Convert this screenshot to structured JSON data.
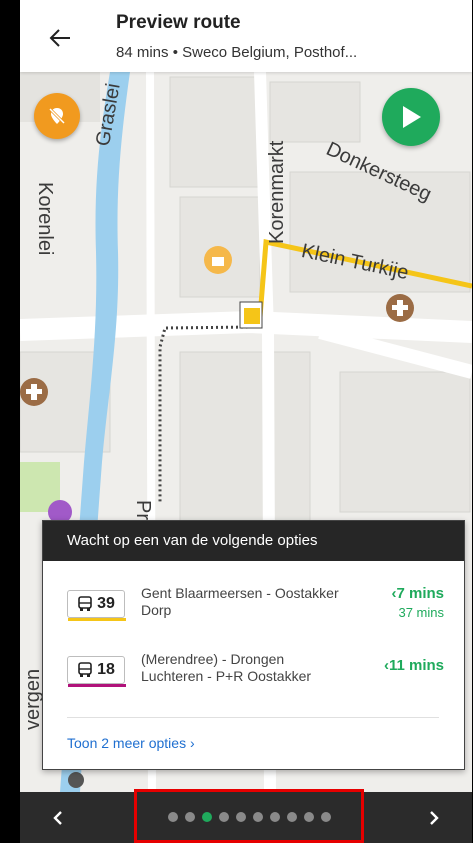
{
  "header": {
    "back_icon": "arrow-left-icon",
    "title": "Preview route",
    "subtitle": "84 mins • Sweco Belgium, Posthof..."
  },
  "map": {
    "labels": {
      "graslei": "Graslei",
      "korenlei": "Korenlei",
      "korenmarkt": "Korenmarkt",
      "donkersteeg": "Donkersteeg",
      "klein_turkije": "Klein Turkije",
      "pre": "Pre",
      "vergen": "vergen"
    },
    "buttons": {
      "location_off_icon": "location-off-icon",
      "start_icon": "play-icon"
    },
    "colors": {
      "water": "#9ccfee",
      "route": "#f5c518",
      "walk": "#444444",
      "green_area": "#cde7b0"
    }
  },
  "card": {
    "header": "Wacht op een van de volgende opties",
    "options": [
      {
        "line": "39",
        "line_color": "#f5c518",
        "destination": "Gent Blaarmeersen - Oostakker Dorp",
        "time": "7 mins",
        "time_sub": "37 mins"
      },
      {
        "line": "18",
        "line_color": "#b0127a",
        "destination": "(Merendree) - Drongen Luchteren - P+R Oostakker",
        "time": "11 mins",
        "time_sub": ""
      }
    ],
    "more_link": "Toon 2 meer opties ›"
  },
  "bottom_nav": {
    "prev_icon": "chevron-left-icon",
    "next_icon": "chevron-right-icon",
    "page_count": 10,
    "active_page": 3
  }
}
